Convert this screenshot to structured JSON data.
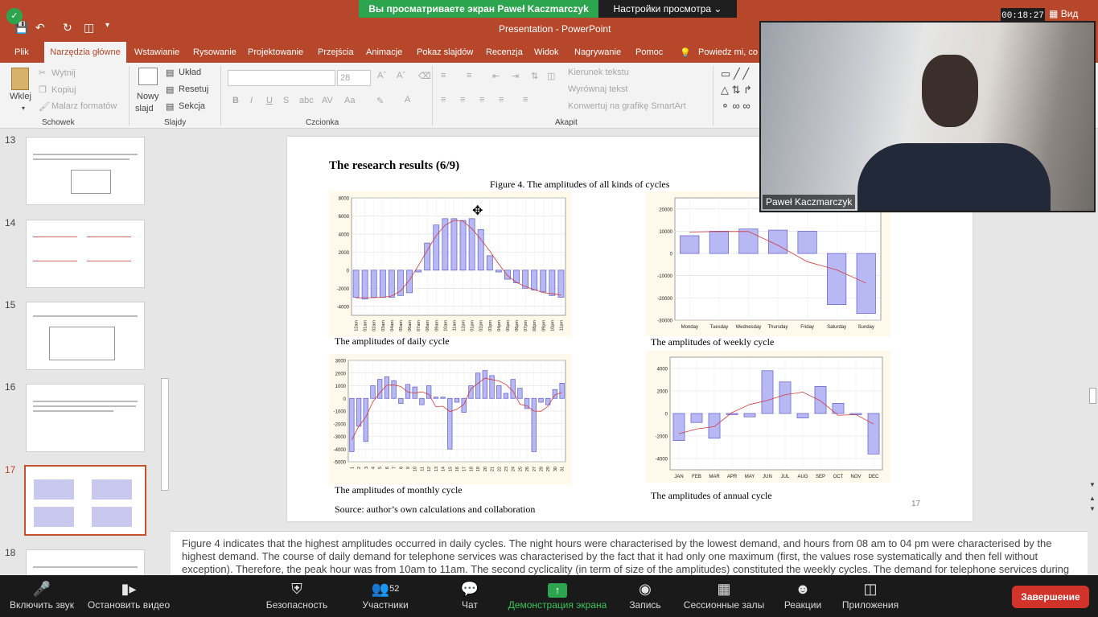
{
  "zoom": {
    "banner": "Вы просматриваете экран Paweł Kaczmarczyk",
    "view_settings": "Настройки просмотра",
    "timer": "00:18:27",
    "view_label": "Вид",
    "camera_name": "Paweł Kaczmarczyk",
    "toolbar": {
      "mute": "Включить звук",
      "video": "Остановить видео",
      "security": "Безопасность",
      "participants": "Участники",
      "participant_count": "52",
      "chat": "Чат",
      "share": "Демонстрация экрана",
      "record": "Запись",
      "breakout": "Сессионные залы",
      "reactions": "Реакции",
      "apps": "Приложения",
      "end": "Завершение"
    }
  },
  "ppt": {
    "app_title": "Presentation  -  PowerPoint",
    "tabs": [
      "Plik",
      "Narzędzia główne",
      "Wstawianie",
      "Rysowanie",
      "Projektowanie",
      "Przejścia",
      "Animacje",
      "Pokaz slajdów",
      "Recenzja",
      "Widok",
      "Nagrywanie",
      "Pomoc"
    ],
    "tell_me": "Powiedz mi, co c",
    "ribbon": {
      "paste": "Wklej",
      "cut": "Wytnij",
      "copy": "Kopiuj",
      "format_painter": "Malarz formatów",
      "clipboard": "Schowek",
      "new_slide_1": "Nowy",
      "new_slide_2": "slajd",
      "layout": "Układ",
      "reset": "Resetuj",
      "section": "Sekcja",
      "slides": "Slajdy",
      "font_size": "28",
      "font": "Czcionka",
      "text_dir": "Kierunek tekstu",
      "align_text": "Wyrównaj tekst",
      "smartart": "Konwertuj na grafikę SmartArt",
      "paragraph": "Akapit"
    },
    "slide_numbers": [
      "13",
      "14",
      "15",
      "16",
      "17",
      "18"
    ],
    "notes": "Figure 4 indicates that the highest amplitudes occurred in daily cycles. The night hours were characterised by the lowest demand, and hours from 08 am to 04 pm were characterised by the highest demand. The course of daily demand for telephone services was characterised by the fact that it had only one maximum (first, the values rose systematically and then fell without exception). Therefore, the peak hour was from 10am to 11am. The second cyclicality (in term of size of the amplitudes) constituted the weekly cycles. The demand for telephone services during"
  },
  "slide": {
    "heading": "The research results (6/9)",
    "figure_title": "Figure 4. The amplitudes of all kinds of cycles",
    "page_number": "17",
    "source": "Source: author’s own calculations and collaboration"
  },
  "chart_data": [
    {
      "type": "bar",
      "title": "",
      "caption": "The amplitudes of daily cycle",
      "categories": [
        "12am",
        "01am",
        "02am",
        "03am",
        "04am",
        "05am",
        "06am",
        "07am",
        "08am",
        "09am",
        "10am",
        "11am",
        "12pm",
        "01pm",
        "02pm",
        "03pm",
        "04pm",
        "05pm",
        "06pm",
        "07pm",
        "08pm",
        "09pm",
        "10pm",
        "11pm"
      ],
      "values": [
        -3000,
        -3200,
        -3000,
        -3000,
        -3000,
        -2800,
        -2500,
        -200,
        3000,
        5000,
        5700,
        5700,
        5500,
        5700,
        4500,
        1600,
        -200,
        -1000,
        -1400,
        -2000,
        -2200,
        -2400,
        -2800,
        -3000
      ],
      "ylim": [
        -5000,
        8000
      ],
      "yticks": [
        -4000,
        -2000,
        0,
        2000,
        4000,
        6000,
        8000
      ]
    },
    {
      "type": "bar",
      "title": "",
      "caption": "The amplitudes of weekly cycle",
      "categories": [
        "Monday",
        "Tuesday",
        "Wednesday",
        "Thursday",
        "Friday",
        "Saturday",
        "Sunday"
      ],
      "values": [
        8000,
        10000,
        11000,
        10500,
        10000,
        -23000,
        -27000
      ],
      "ylim": [
        -30000,
        25000
      ],
      "yticks": [
        -30000,
        -20000,
        -10000,
        0,
        10000,
        20000
      ]
    },
    {
      "type": "bar",
      "title": "",
      "caption": "The amplitudes of monthly cycle",
      "categories": [
        "1",
        "2",
        "3",
        "4",
        "5",
        "6",
        "7",
        "8",
        "9",
        "10",
        "11",
        "12",
        "13",
        "14",
        "15",
        "16",
        "17",
        "18",
        "19",
        "20",
        "21",
        "22",
        "23",
        "24",
        "25",
        "26",
        "27",
        "28",
        "29",
        "30",
        "31"
      ],
      "values": [
        -4200,
        -2200,
        -3400,
        1000,
        1500,
        1700,
        1400,
        -400,
        1100,
        900,
        -500,
        1000,
        100,
        100,
        -4000,
        -300,
        -1100,
        1000,
        2000,
        2200,
        1800,
        1000,
        400,
        1500,
        800,
        -800,
        -4200,
        -300,
        -500,
        700,
        1200,
        700
      ],
      "ylim": [
        -5000,
        3000
      ],
      "yticks": [
        -5000,
        -4000,
        -3000,
        -2000,
        -1000,
        0,
        1000,
        2000,
        3000
      ]
    },
    {
      "type": "bar",
      "title": "",
      "caption": "The amplitudes of annual cycle",
      "categories": [
        "JAN",
        "FEB",
        "MAR",
        "APR",
        "MAY",
        "JUN",
        "JUL",
        "AUG",
        "SEP",
        "OCT",
        "NOV",
        "DEC"
      ],
      "values": [
        -2400,
        -800,
        -2200,
        -100,
        -300,
        3800,
        2800,
        -400,
        2400,
        900,
        -100,
        -3600
      ],
      "ylim": [
        -5000,
        5000
      ],
      "yticks": [
        -4000,
        -2000,
        0,
        2000,
        4000
      ]
    }
  ]
}
